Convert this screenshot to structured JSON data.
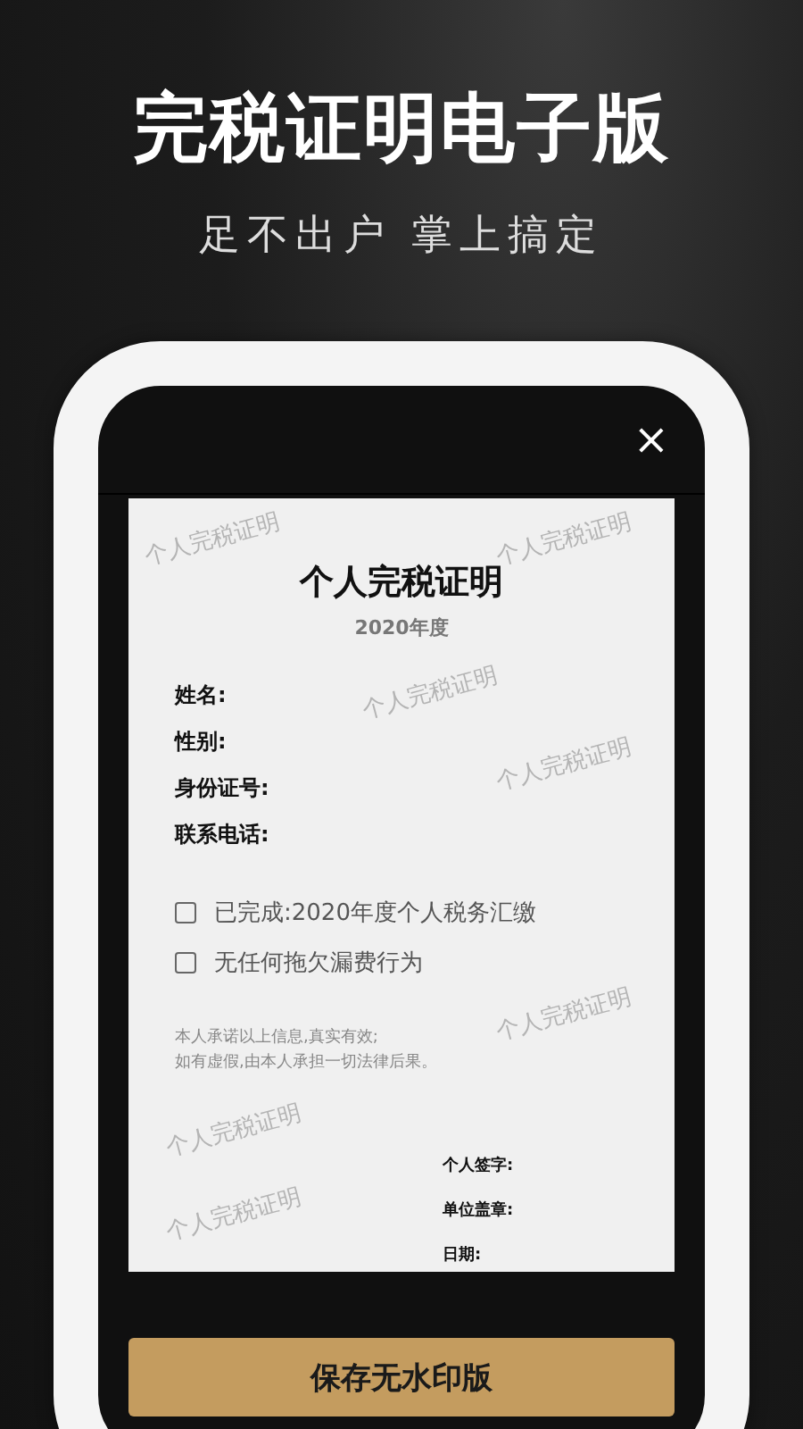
{
  "headline": "完税证明电子版",
  "subheadline": "足不出户 掌上搞定",
  "screen": {
    "close": "×",
    "document": {
      "title": "个人完税证明",
      "year": "2020年度",
      "fields": [
        "姓名:",
        "性别:",
        "身份证号:",
        "联系电话:"
      ],
      "checks": [
        {
          "label": "已完成:2020年度个人税务汇缴",
          "checked": false
        },
        {
          "label": "无任何拖欠漏费行为",
          "checked": false
        }
      ],
      "pledge": [
        "本人承诺以上信息,真实有效;",
        "如有虚假,由本人承担一切法律后果。"
      ],
      "signatures": [
        "个人签字:",
        "单位盖章:",
        "日期:"
      ],
      "watermarks": [
        "个人完税证明",
        "个人完税证明",
        "个人完税证明",
        "个人完税证明",
        "个人完税证明",
        "个人完税证明",
        "个人完税证明"
      ]
    },
    "save_button": "保存无水印版"
  }
}
